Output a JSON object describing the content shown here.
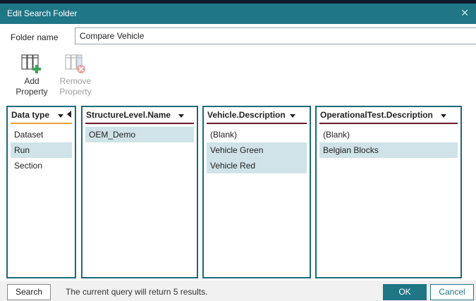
{
  "window": {
    "title": "Edit Search Folder"
  },
  "folder": {
    "label": "Folder name",
    "value": "Compare Vehicle"
  },
  "toolbar": {
    "add": {
      "line1": "Add",
      "line2": "Property",
      "icon": "add-property-icon"
    },
    "remove": {
      "line1": "Remove",
      "line2": "Property",
      "icon": "remove-property-icon"
    }
  },
  "panels": [
    {
      "header": "Data type",
      "items": [
        "Dataset",
        "Run",
        "Section"
      ],
      "selected": [
        1
      ],
      "accent": "#e8a33c"
    },
    {
      "header": "StructureLevel.Name",
      "items": [
        "OEM_Demo"
      ],
      "selected": [
        0
      ],
      "accent": "#6b1a2a"
    },
    {
      "header": "Vehicle.Description",
      "items": [
        "(Blank)",
        "Vehicle Green",
        "Vehicle Red"
      ],
      "selected": [
        1,
        2
      ],
      "accent": "#6b1a2a"
    },
    {
      "header": "OperationalTest.Description",
      "items": [
        "(Blank)",
        "Belgian Blocks"
      ],
      "selected": [
        1
      ],
      "accent": "#6b1a2a"
    }
  ],
  "footer": {
    "search": "Search",
    "status": "The current query will return 5 results.",
    "ok": "OK",
    "cancel": "Cancel"
  },
  "colors": {
    "accent": "#1f7685",
    "selection": "#cfe3e8",
    "border": "#1a6b78"
  }
}
